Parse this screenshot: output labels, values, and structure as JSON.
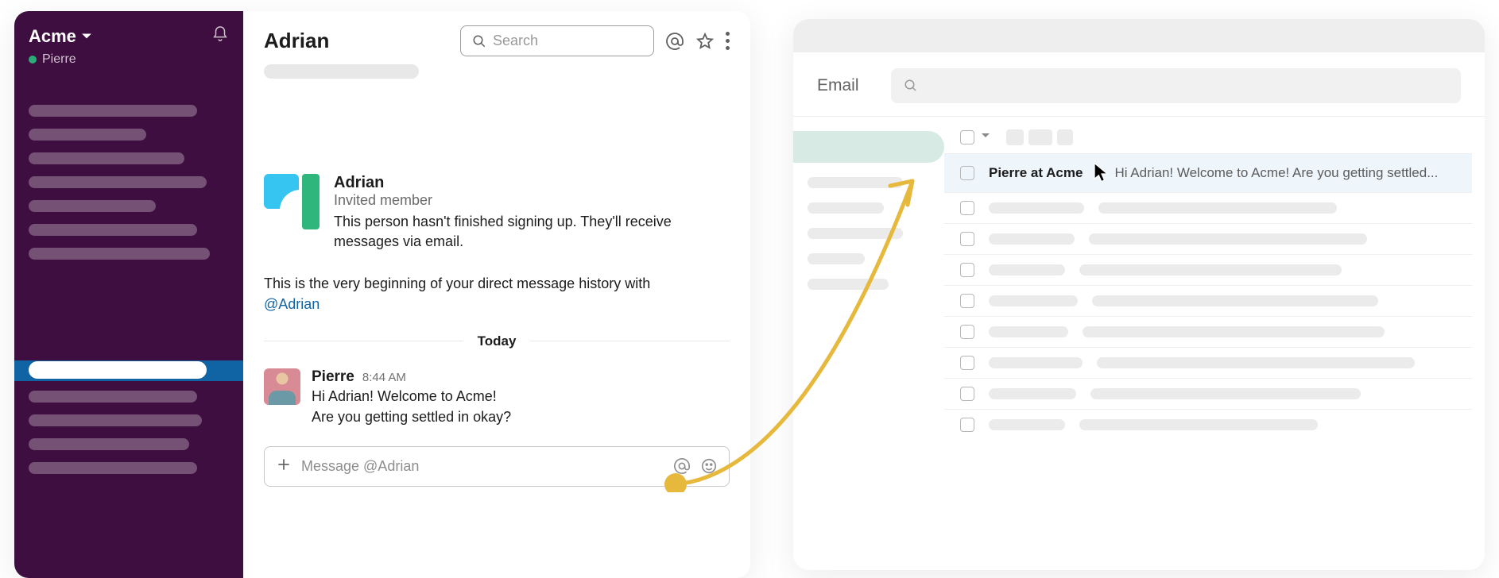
{
  "slack": {
    "workspace": "Acme",
    "current_user": "Pierre",
    "dm_title": "Adrian",
    "search_placeholder": "Search",
    "intro": {
      "name": "Adrian",
      "role": "Invited member",
      "description": "This person hasn't finished signing up. They'll receive messages via email."
    },
    "dm_begin_text": "This is the very beginning of your direct message history with ",
    "dm_begin_mention": "@Adrian",
    "divider_label": "Today",
    "message": {
      "author": "Pierre",
      "time": "8:44 AM",
      "line1": "Hi Adrian! Welcome to Acme!",
      "line2": "Are you getting settled in okay?"
    },
    "composer_placeholder": "Message @Adrian"
  },
  "email": {
    "heading": "Email",
    "inbox_row": {
      "sender": "Pierre at Acme",
      "snippet": "Hi Adrian! Welcome to Acme! Are you getting settled..."
    }
  },
  "colors": {
    "slack_purple": "#3f0e40",
    "slack_active_blue": "#1164a3",
    "arrow_gold": "#e6b83c"
  }
}
